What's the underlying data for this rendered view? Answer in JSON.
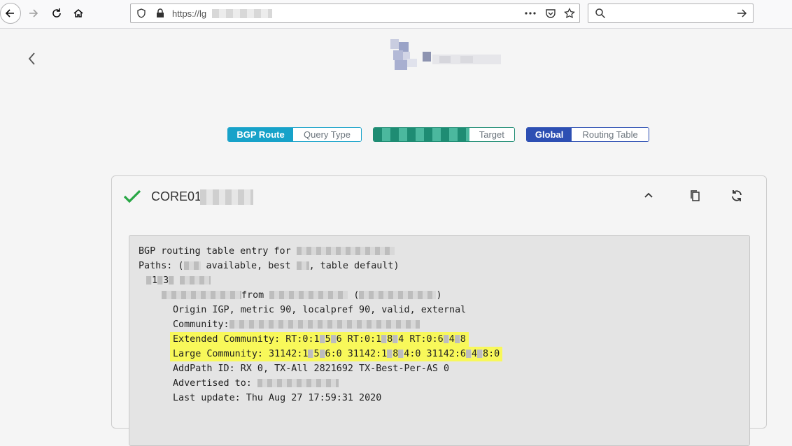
{
  "browser": {
    "url_prefix": "https://lg",
    "icons": [
      "back-icon",
      "forward-icon",
      "reload-icon",
      "home-icon",
      "shield-icon",
      "lock-icon",
      "more-icon",
      "pocket-icon",
      "star-icon",
      "search-icon",
      "go-arrow-icon"
    ]
  },
  "selectors": [
    {
      "active": "BGP Route",
      "label": "Query Type",
      "color": "#17a2c9"
    },
    {
      "active": "",
      "label": "Target",
      "color": "#1e8c73"
    },
    {
      "active": "Global",
      "label": "Routing Table",
      "color": "#2d4fb3"
    }
  ],
  "result": {
    "router_prefix": "CORE01",
    "lines": [
      "BGP routing table entry for",
      "Paths: (",
      " available, best ",
      ", table default)",
      "from",
      "(",
      ")",
      "Origin IGP, metric 90, localpref 90, valid, external",
      "Community:",
      "Extended Community: RT:0:1",
      "5",
      "6 RT:0:1",
      "8",
      "4 RT:0:6",
      "4",
      "8",
      "Large Community: 31142:1",
      "5",
      "6:0 31142:1",
      "8",
      "4:0 31142:6",
      "4",
      "8:0",
      "AddPath ID: RX 0, TX-All 2821692 TX-Best-Per-AS 0",
      "Advertised to:",
      "Last update: Thu Aug 27 17:59:31 2020",
      "1",
      "3"
    ]
  }
}
